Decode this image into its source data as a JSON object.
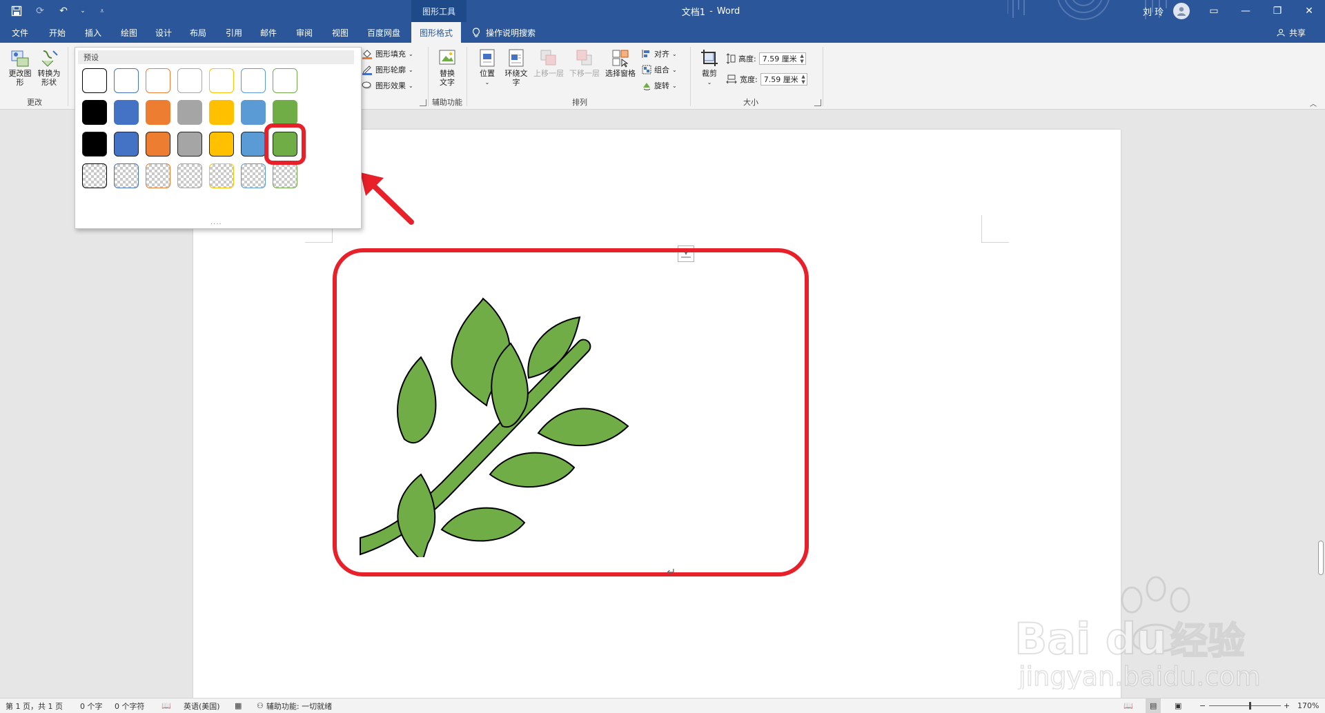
{
  "titlebar": {
    "context_tools": "图形工具",
    "doc_name": "文档1",
    "separator": "-",
    "app_name": "Word",
    "user_name": "刘 玲"
  },
  "tabs": [
    {
      "label": "文件"
    },
    {
      "label": "开始"
    },
    {
      "label": "插入"
    },
    {
      "label": "绘图"
    },
    {
      "label": "设计"
    },
    {
      "label": "布局"
    },
    {
      "label": "引用"
    },
    {
      "label": "邮件"
    },
    {
      "label": "审阅"
    },
    {
      "label": "视图"
    },
    {
      "label": "百度网盘"
    },
    {
      "label": "图形格式"
    }
  ],
  "tellme": "操作说明搜索",
  "share": "共享",
  "ribbon": {
    "change_shape": "更改图形",
    "convert_shape": "转换为形状",
    "group_change": "更改",
    "shape_fill": "图形填充",
    "shape_outline": "图形轮廓",
    "shape_effects": "图形效果",
    "alt_text": "替换文字",
    "group_accessibility": "辅助功能",
    "position": "位置",
    "wrap_text": "环绕文字",
    "bring_forward": "上移一层",
    "send_backward": "下移一层",
    "selection_pane": "选择窗格",
    "align": "对齐",
    "group": "组合",
    "rotate": "旋转",
    "group_arrange": "排列",
    "crop": "裁剪",
    "height_label": "高度:",
    "height_value": "7.59 厘米",
    "width_label": "宽度:",
    "width_value": "7.59 厘米",
    "group_size": "大小"
  },
  "gallery": {
    "header": "预设",
    "more": "....",
    "colors": {
      "black": "#000000",
      "blue": "#4472c4",
      "orange": "#ed7d31",
      "gray": "#a5a5a5",
      "gold": "#ffc000",
      "lightblue": "#5b9bd5",
      "green": "#70ad47"
    },
    "selected_row": 3,
    "selected_col": 7
  },
  "document": {
    "leaf_color": "#70ad47",
    "highlight_color": "#e8202a",
    "paragraph_mark": "↵"
  },
  "status": {
    "page": "第 1 页，共 1 页",
    "words": "0 个字",
    "chars": "0 个字符",
    "language": "英语(美国)",
    "accessibility": "辅助功能: 一切就绪",
    "zoom": "170%"
  },
  "watermark": {
    "brand": "Bai du",
    "brand_cn": "经验",
    "url": "jingyan.baidu.com"
  }
}
